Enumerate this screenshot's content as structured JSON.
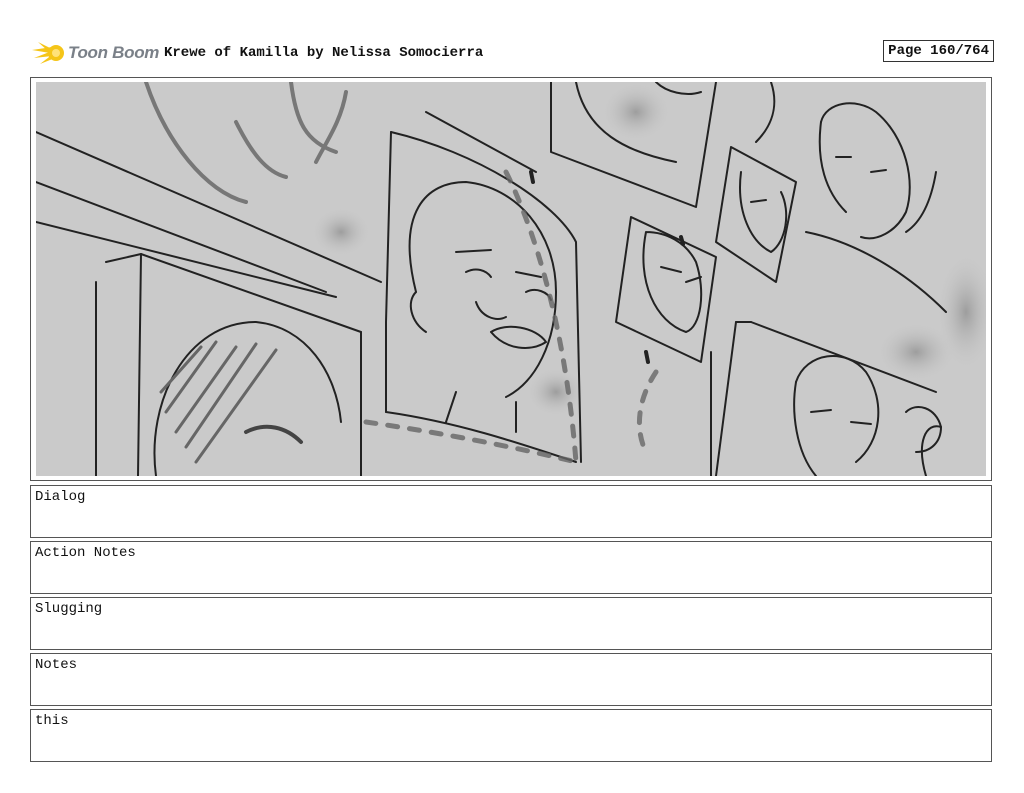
{
  "header": {
    "logo_text": "Toon Boom",
    "title": "Krewe of Kamilla by Nelissa Somocierra",
    "page_number": "Page 160/764"
  },
  "panel": {
    "description_icon": "storyboard-sketch-image"
  },
  "fields": [
    {
      "label": "Dialog"
    },
    {
      "label": "Action Notes"
    },
    {
      "label": "Slugging"
    },
    {
      "label": "Notes"
    },
    {
      "label": "this"
    }
  ],
  "colors": {
    "logo_yellow": "#f5c518",
    "panel_gray": "#cacaca",
    "sketch_line": "#222222"
  }
}
